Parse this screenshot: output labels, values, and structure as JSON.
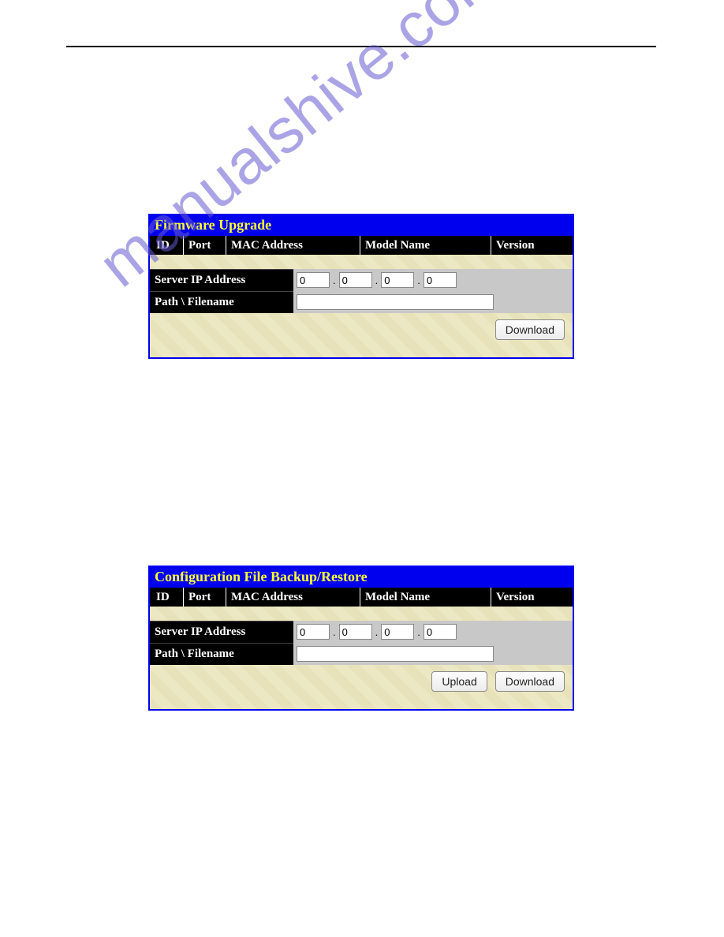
{
  "watermark": "manualshive.com",
  "panel1": {
    "title": "Firmware Upgrade",
    "columns": {
      "id": "ID",
      "port": "Port",
      "mac": "MAC Address",
      "model": "Model Name",
      "version": "Version"
    },
    "labels": {
      "server_ip": "Server IP Address",
      "path": "Path \\ Filename"
    },
    "ip": {
      "o1": "0",
      "o2": "0",
      "o3": "0",
      "o4": "0"
    },
    "path_value": "",
    "download_label": "Download"
  },
  "panel2": {
    "title": "Configuration File Backup/Restore",
    "columns": {
      "id": "ID",
      "port": "Port",
      "mac": "MAC Address",
      "model": "Model Name",
      "version": "Version"
    },
    "labels": {
      "server_ip": "Server IP Address",
      "path": "Path \\ Filename"
    },
    "ip": {
      "o1": "0",
      "o2": "0",
      "o3": "0",
      "o4": "0"
    },
    "path_value": "",
    "upload_label": "Upload",
    "download_label": "Download"
  }
}
